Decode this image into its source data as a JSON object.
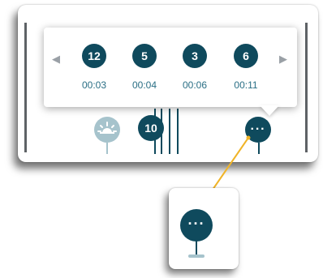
{
  "popup": {
    "prev_arrow": "◀",
    "next_arrow": "▶",
    "clusters": [
      {
        "count": "12",
        "time": "00:03"
      },
      {
        "count": "5",
        "time": "00:04"
      },
      {
        "count": "3",
        "time": "00:06"
      },
      {
        "count": "6",
        "time": "00:11"
      }
    ]
  },
  "timeline": {
    "cluster_marker": "10",
    "more_marker": "···"
  },
  "zoom": {
    "more_marker": "···"
  },
  "colors": {
    "marker": "#0f4a5d",
    "time_text": "#2a6f85",
    "sun_marker": "#a6c3cc",
    "connector": "#f0b428"
  }
}
